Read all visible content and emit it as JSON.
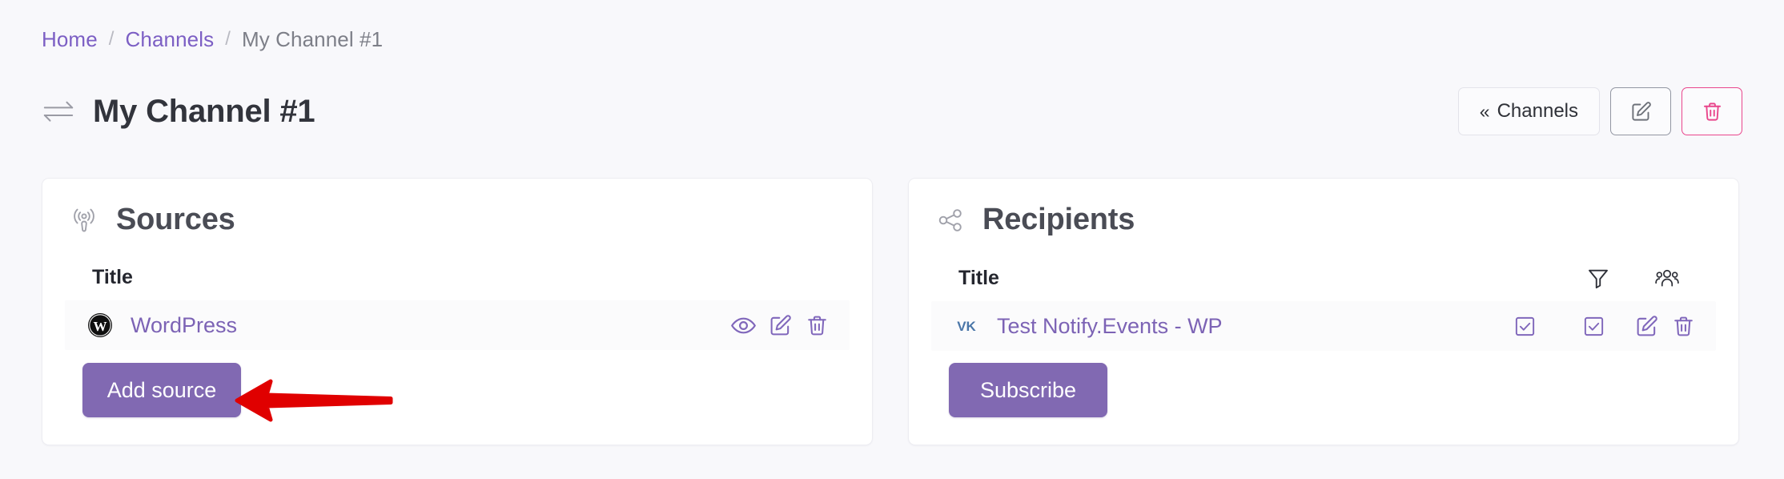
{
  "breadcrumb": {
    "separator": "/",
    "items": [
      {
        "label": "Home",
        "current": false
      },
      {
        "label": "Channels",
        "current": false
      },
      {
        "label": "My Channel #1",
        "current": true
      }
    ]
  },
  "header": {
    "title": "My Channel #1",
    "title_icon": "exchange-arrows-icon",
    "actions": {
      "back_chevron": "«",
      "back_label": "Channels",
      "edit_icon": "edit-pencil-icon",
      "delete_icon": "trash-icon"
    }
  },
  "colors": {
    "page_background": "#f8f8fb",
    "card_background": "#ffffff",
    "accent_purple": "#8169b2",
    "link_purple": "#7c63b5",
    "breadcrumb_link": "#7c5fc4",
    "danger_pink": "#e9468c",
    "annotation_red": "#e00000",
    "vk_blue": "#4a76a8"
  },
  "cards": [
    {
      "id": "sources",
      "icon": "broadcast-podcast-icon",
      "title": "Sources",
      "columns": {
        "title": "Title",
        "icons": []
      },
      "rows": [
        {
          "brand_icon": "wordpress-icon",
          "label": "WordPress",
          "actions": [
            "eye-icon",
            "edit-pencil-icon",
            "trash-icon"
          ]
        }
      ],
      "primary_button": "Add source"
    },
    {
      "id": "recipients",
      "icon": "share-nodes-icon",
      "title": "Recipients",
      "columns": {
        "title": "Title",
        "icons": [
          "filter-funnel-icon",
          "people-group-icon"
        ]
      },
      "rows": [
        {
          "brand_icon": "vk-icon",
          "label": "Test Notify.Events - WP",
          "actions": [
            "checkbox-checked-icon",
            "checkbox-checked-icon",
            "edit-pencil-icon",
            "trash-icon"
          ]
        }
      ],
      "primary_button": "Subscribe"
    }
  ],
  "annotation": {
    "type": "arrow",
    "direction": "left",
    "points_to": "Add source",
    "color": "#e00000"
  }
}
